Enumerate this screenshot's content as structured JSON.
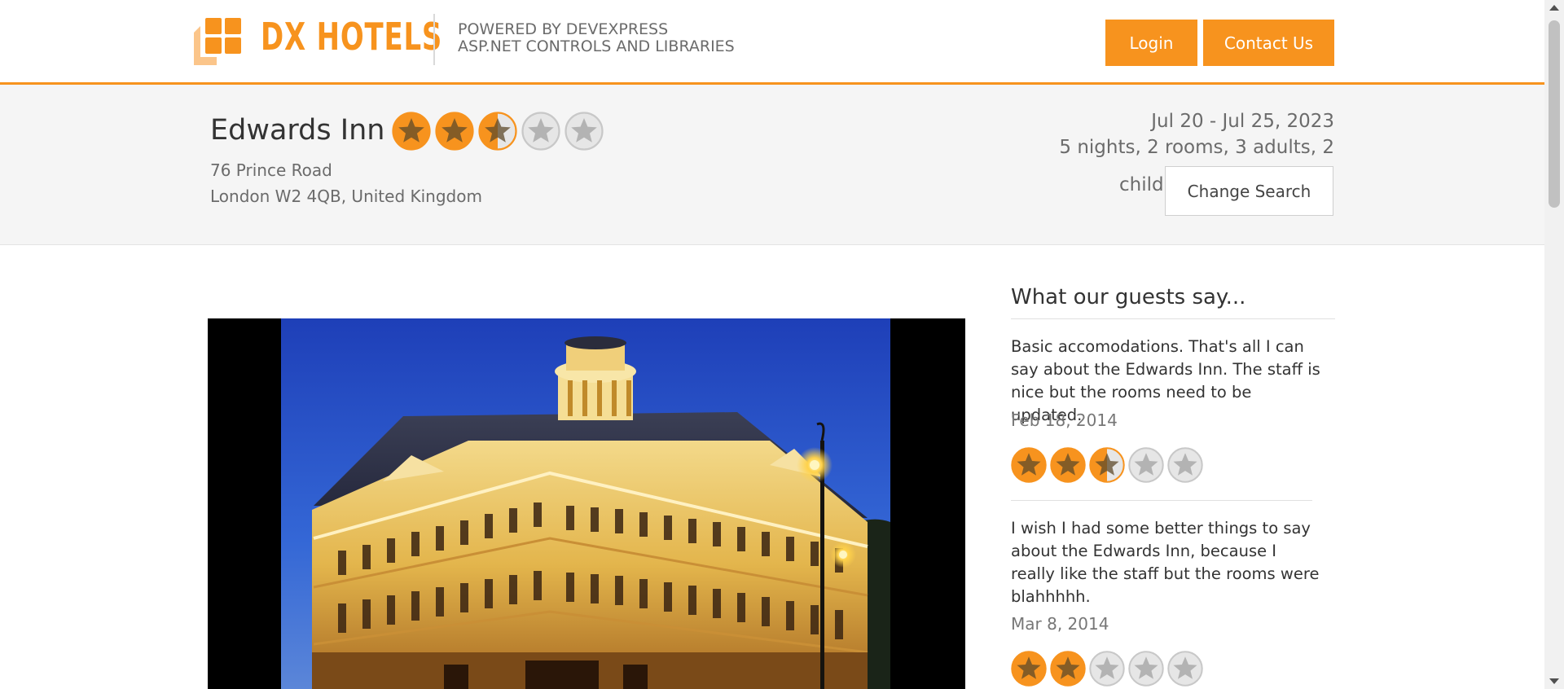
{
  "brand": {
    "name": "DX HOTELS",
    "powered_line1": "POWERED BY DEVEXPRESS",
    "powered_line2": "ASP.NET CONTROLS AND LIBRARIES",
    "accent_color": "#f7931e"
  },
  "header": {
    "login_label": "Login",
    "contact_label": "Contact Us"
  },
  "hotel": {
    "name": "Edwards Inn",
    "rating": 2.5,
    "rating_max": 5,
    "address_line1": "76 Prince Road",
    "address_line2": "London W2 4QB, United Kingdom"
  },
  "search": {
    "dates": "Jul 20 - Jul 25, 2023",
    "guests_line1": "5 nights, 2 rooms, 3 adults, 2",
    "guests_line2": "child",
    "change_label": "Change Search"
  },
  "photo": {
    "icon": "hotel-photo"
  },
  "reviews": {
    "title": "What our guests say...",
    "items": [
      {
        "text": "Basic accomodations. That's all I can say about the Edwards Inn. The staff is nice but the rooms need to be updated.",
        "date": "Feb 18, 2014",
        "rating": 2.5
      },
      {
        "text": "I wish I had some better things to say about the Edwards Inn, because I really like the staff but the rooms were blahhhhh.",
        "date": "Mar 8, 2014",
        "rating": 2
      }
    ]
  }
}
